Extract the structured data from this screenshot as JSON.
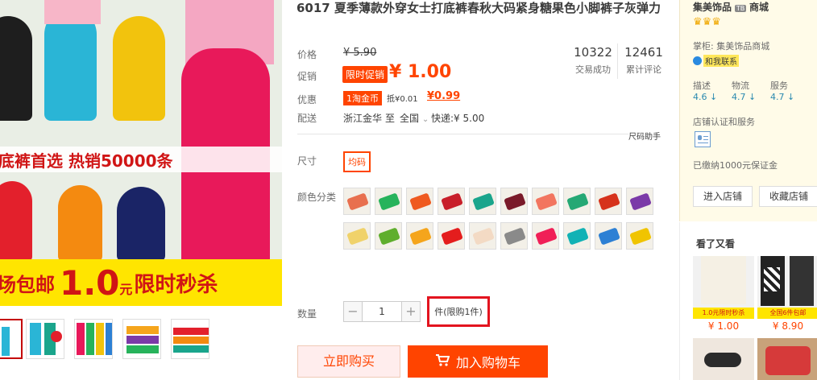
{
  "gallery": {
    "banner_mid": "底裤首选  热销50000条",
    "banner_bottom_prefix": "场包邮",
    "banner_bottom_big": "1.0",
    "banner_bottom_unit": "元",
    "banner_bottom_suffix": "限时秒杀"
  },
  "product": {
    "title": "6017 夏季薄款外穿女士打底裤春秋大码紧身糖果色小脚裤子灰弹力",
    "price_label": "价格",
    "price_original": "¥ 5.90",
    "promo_label": "促销",
    "promo_tag": "限时促销",
    "promo_price": "¥ 1.00",
    "discount_label": "优惠",
    "coin_tag": "1淘金币",
    "coin_deduct": "抵¥0.01",
    "coin_price": "¥0.99",
    "ship_label": "配送",
    "ship_from": "浙江金华",
    "ship_to_word": "至",
    "ship_to": "全国",
    "ship_fee": "快递:¥ 5.00",
    "size_helper": "尺码助手",
    "size_label": "尺寸",
    "size_option": "均码",
    "color_label": "颜色分类",
    "qty_label": "数量",
    "qty_value": "1",
    "qty_unit": "件",
    "qty_limit": "(限购1件)",
    "buy_now": "立即购买",
    "add_cart": "加入购物车"
  },
  "stats": [
    {
      "num": "10322",
      "label": "交易成功"
    },
    {
      "num": "12461",
      "label": "累计评论"
    }
  ],
  "swatch_colors": [
    "#e8704f",
    "#27b35b",
    "#ef5a1f",
    "#c81f2a",
    "#1aa58c",
    "#7a1a2a",
    "#f2755f",
    "#25a874",
    "#d6321b",
    "#7b3aa8",
    "#f0d26a",
    "#5fae2d",
    "#f5a51c",
    "#e41d1d",
    "#f3dac4",
    "#8a8a8a",
    "#f01f57",
    "#12b2b5",
    "#2d80d4",
    "#f0c400"
  ],
  "shop": {
    "name": "集美饰品",
    "badge": "TB",
    "suffix": "商城",
    "crowns": "♛♛♛",
    "keeper_label": "掌柜:",
    "keeper_name": "集美饰品商城",
    "contact": "和我联系",
    "scores": [
      {
        "label": "描述",
        "value": "4.6"
      },
      {
        "label": "物流",
        "value": "4.7"
      },
      {
        "label": "服务",
        "value": "4.7"
      }
    ],
    "cert_label": "店铺认证和服务",
    "deposit": "已缴纳1000元保证金",
    "enter_btn": "进入店铺",
    "fav_btn": "收藏店铺"
  },
  "seen": {
    "title": "看了又看",
    "items": [
      {
        "price": "¥ 1.00",
        "tag": "1.0元限时秒杀"
      },
      {
        "price": "¥ 8.90",
        "tag": "全国6件包邮"
      }
    ]
  },
  "icons": {
    "arrow_down": "↓",
    "cart": "🛒",
    "minus": "−",
    "plus": "+",
    "chevron": "⌄"
  }
}
